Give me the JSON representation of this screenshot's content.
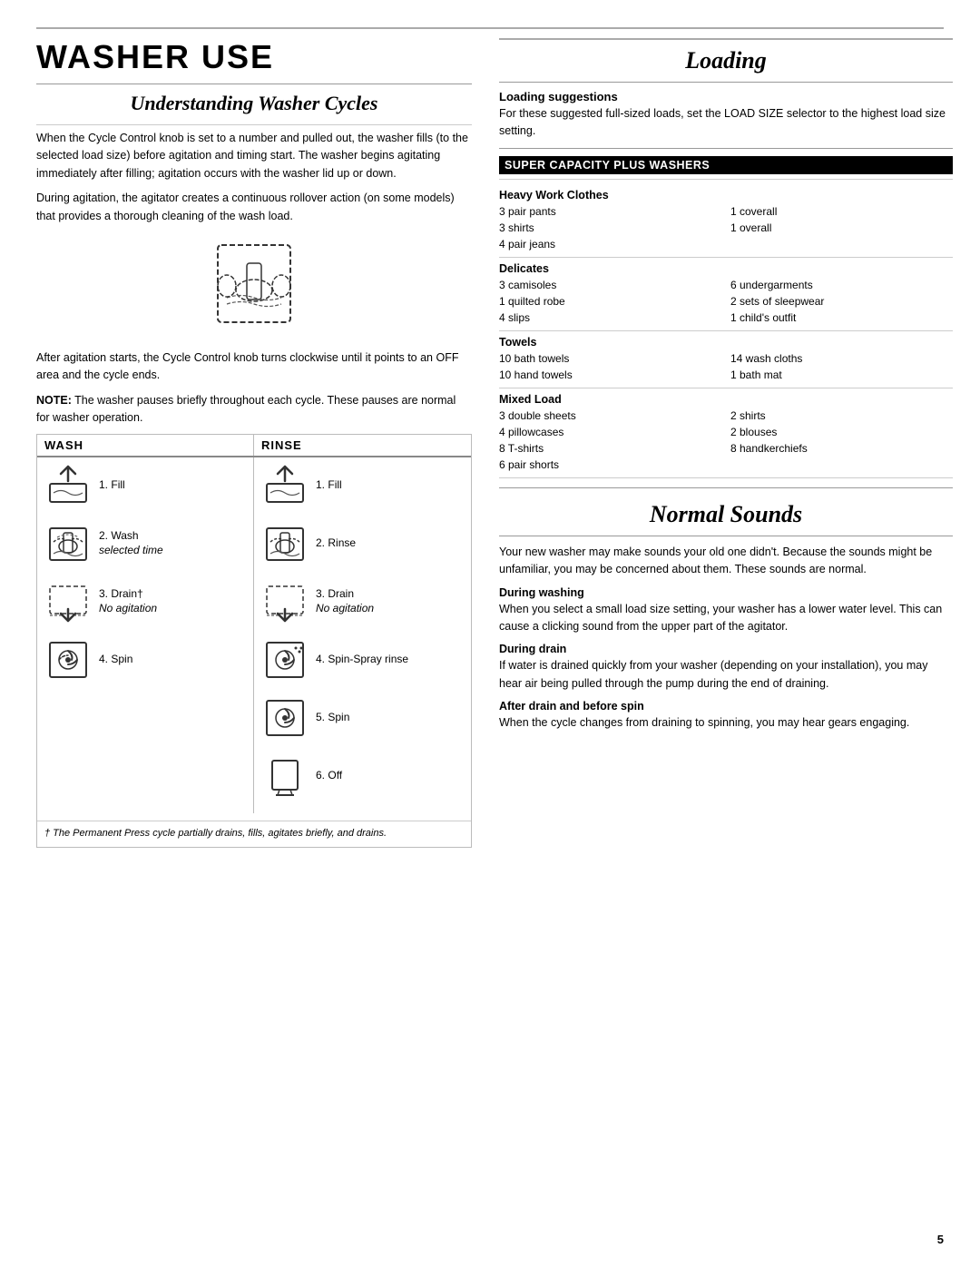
{
  "page": {
    "page_number": "5"
  },
  "left": {
    "main_title": "WASHER USE",
    "subtitle": "Understanding Washer Cycles",
    "body_paragraphs": [
      "When the Cycle Control knob is set to a number and pulled out, the washer fills (to the selected load size) before agitation and timing start. The washer begins agitating immediately after filling; agitation occurs with the washer lid up or down.",
      "During agitation, the agitator creates a continuous rollover action (on some models) that provides a thorough cleaning of the wash load."
    ],
    "after_agitation_text": "After agitation starts, the Cycle Control knob turns clockwise until it points to an OFF area and the cycle ends.",
    "note_text": "NOTE: The washer pauses briefly throughout each cycle. These pauses are normal for washer operation.",
    "wash_col_label": "WASH",
    "rinse_col_label": "RINSE",
    "wash_steps": [
      {
        "num": "1.",
        "label": "Fill"
      },
      {
        "num": "2.",
        "label": "Wash\nselected time"
      },
      {
        "num": "3.",
        "label": "Drain†\nNo agitation"
      },
      {
        "num": "4.",
        "label": "Spin"
      }
    ],
    "rinse_steps": [
      {
        "num": "1.",
        "label": "Fill"
      },
      {
        "num": "2.",
        "label": "Rinse"
      },
      {
        "num": "3.",
        "label": "Drain\nNo agitation"
      },
      {
        "num": "4.",
        "label": "Spin-Spray rinse"
      },
      {
        "num": "5.",
        "label": "Spin"
      },
      {
        "num": "6.",
        "label": "Off"
      }
    ],
    "footnote": "† The Permanent Press cycle partially drains, fills, agitates briefly, and drains."
  },
  "right": {
    "loading_title": "Loading",
    "loading_suggestions_label": "Loading suggestions",
    "loading_suggestions_text": "For these suggested full-sized loads, set the LOAD SIZE selector to the highest load size setting.",
    "super_capacity_label": "SUPER CAPACITY PLUS WASHERS",
    "load_sections": [
      {
        "title": "Heavy Work Clothes",
        "col1": [
          "3 pair pants",
          "3 shirts",
          "4 pair jeans"
        ],
        "col2": [
          "1 coverall",
          "1 overall"
        ]
      },
      {
        "title": "Delicates",
        "col1": [
          "3 camisoles",
          "1 quilted robe",
          "4 slips"
        ],
        "col2": [
          "6 undergarments",
          "2 sets of sleepwear",
          "1 child's outfit"
        ]
      },
      {
        "title": "Towels",
        "col1": [
          "10 bath towels",
          "10 hand towels"
        ],
        "col2": [
          "14 wash cloths",
          "1 bath mat"
        ]
      },
      {
        "title": "Mixed Load",
        "col1": [
          "3 double sheets",
          "4 pillowcases",
          "8 T-shirts",
          "6 pair shorts"
        ],
        "col2": [
          "2 shirts",
          "2 blouses",
          "8 handkerchiefs"
        ]
      }
    ],
    "normal_sounds_title": "Normal Sounds",
    "normal_sounds_intro": "Your new washer may make sounds your old one didn't. Because the sounds might be unfamiliar, you may be concerned about them. These sounds are normal.",
    "during_sections": [
      {
        "label": "During washing",
        "text": "When you select a small load size setting, your washer has a lower water level. This can cause a clicking sound from the upper part of the agitator."
      },
      {
        "label": "During drain",
        "text": "If water is drained quickly from your washer (depending on your installation), you may hear air being pulled through the pump during the end of draining."
      },
      {
        "label": "After drain and before spin",
        "text": "When the cycle changes from draining to spinning, you may hear gears engaging."
      }
    ]
  }
}
